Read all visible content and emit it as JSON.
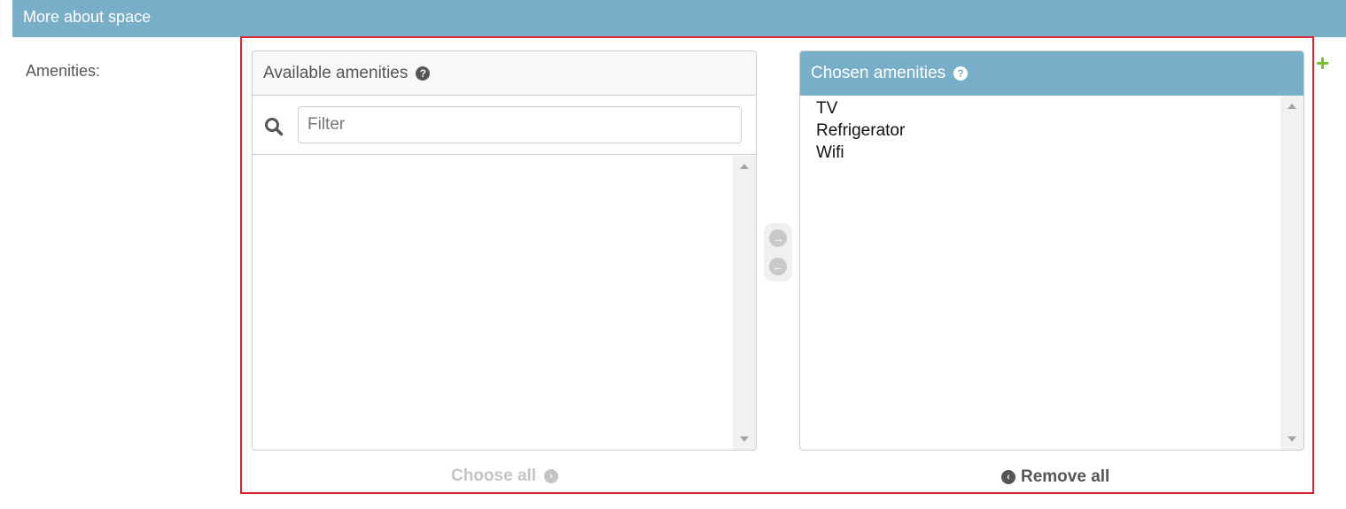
{
  "fieldset": {
    "title": "More about space"
  },
  "field": {
    "label": "Amenities:"
  },
  "available": {
    "title": "Available amenities",
    "filter_placeholder": "Filter",
    "filter_value": "",
    "options": []
  },
  "chosen": {
    "title": "Chosen amenities",
    "options": [
      "TV",
      "Refrigerator",
      "Wifi"
    ]
  },
  "actions": {
    "choose_all": "Choose all",
    "remove_all": "Remove all"
  },
  "colors": {
    "header": "#79aec8",
    "highlight": "#d9262f",
    "add": "#70bf2b"
  },
  "icons": {
    "help": "question-circle-icon",
    "search": "search-icon",
    "add_arrow": "arrow-right-circle-icon",
    "remove_arrow": "arrow-left-circle-icon",
    "add_related": "plus-icon"
  }
}
